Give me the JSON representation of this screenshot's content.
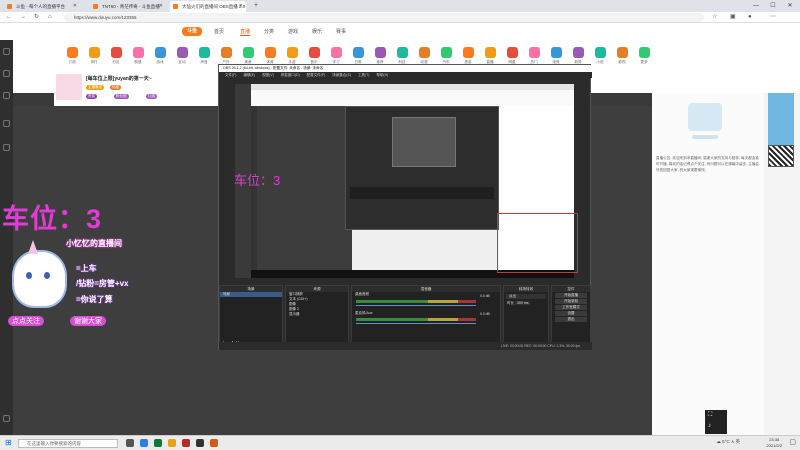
{
  "browser": {
    "tabs": [
      {
        "title": "斗鱼 - 每个人的直播平台"
      },
      {
        "title": "TNT60 - 青茫传奇 - 斗鱼直播"
      },
      {
        "title": "大仙火们的直播间 OBS直播 2.0"
      }
    ],
    "url": "https://www.douyu.com/123355",
    "win_min": "—",
    "win_max": "☐",
    "win_close": "✕"
  },
  "site": {
    "logo": "斗鱼",
    "nav": [
      "首页",
      "直播",
      "分类",
      "游戏",
      "娱乐",
      "赛事"
    ],
    "categories": [
      "订阅",
      "排行",
      "分区",
      "颜值",
      "游戏",
      "互动",
      "声音",
      "户外",
      "美食",
      "体育",
      "手游",
      "音乐",
      "学习",
      "日常",
      "推荐",
      "科技",
      "动漫",
      "汽车",
      "旅游",
      "直播",
      "明星",
      "热门",
      "电竞",
      "新秀",
      "小说",
      "影视",
      "更多"
    ]
  },
  "room": {
    "title": "[每车位上限]yuyan的第一天~",
    "tags": [
      "主播等级",
      "热度",
      "贵族",
      "粉丝团",
      "订阅"
    ]
  },
  "obs": {
    "window_title": "OBS 26.1.2 (64-bit, windows) - 配置文件: 未命名 - 场景: 未命名",
    "menu": [
      "文件(F)",
      "编辑(E)",
      "视图(V)",
      "停靠窗口(D)",
      "配置文件(P)",
      "场景集合(S)",
      "工具(T)",
      "帮助(H)"
    ],
    "docks": {
      "scenes": "场景",
      "sources": "来源",
      "mixer": "混音器",
      "transitions": "转场特效",
      "controls": "控件"
    },
    "scene_items": [
      "场景"
    ],
    "source_items": [
      "窗口捕获",
      "文本 (GDI+)",
      "图像",
      "图像 2",
      "显示器"
    ],
    "mixer_items": [
      "桌面音频",
      "麦克风/Aux"
    ],
    "mixer_db": [
      "0.0 dB",
      "0.0 dB"
    ],
    "transition": {
      "type": "淡出",
      "duration_label": "时长",
      "duration": "300 ms"
    },
    "controls": [
      "开始直播",
      "开始录制",
      "工作室模式",
      "设置",
      "退出"
    ],
    "status": "LIVE: 00:00:00    REC: 00:00:00    CPU: 1.3%, 30.00 fps"
  },
  "overlay": {
    "car_position": "车位：3",
    "live_room": "小忆忆的直播间",
    "lines": [
      "=上车",
      "/钻粉=房管+vx",
      "=你说了算"
    ],
    "bottom_tags": [
      "点点关注",
      "谢谢大家"
    ]
  },
  "right_panel": {
    "ad_text": "直播公告: 欢迎来到本直播间, 感谢大家的支持与陪伴, 每天都会准时开播, 喜欢的话记得点个关注, 有问题可以在弹幕中留言, 主播会尽快回复大家, 祝大家观看愉快。"
  },
  "taskbar": {
    "search_placeholder": "在这里输入你要搜索的内容",
    "tray": "☁ 5°C ∧ 英",
    "time": "23:38",
    "date": "2021/2/2"
  },
  "colors": {
    "accent": "#ff5500",
    "overlay_pink": "#e33bd8",
    "obs_bg": "#2b2b2b"
  }
}
